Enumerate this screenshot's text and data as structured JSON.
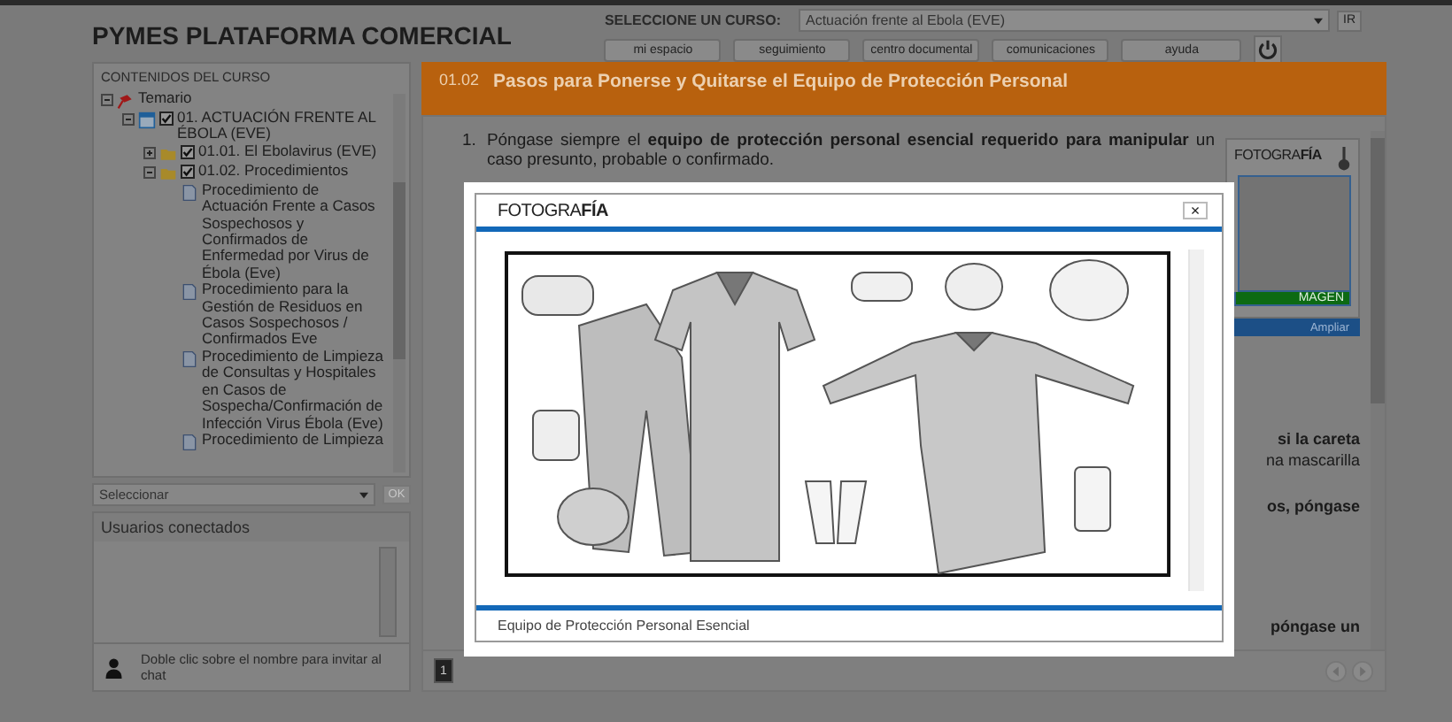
{
  "header": {
    "title": "PYMES PLATAFORMA COMERCIAL",
    "course_label": "SELECCIONE UN CURSO:",
    "course_value": "Actuación frente al Ebola (EVE)",
    "go_button": "IR",
    "nav": [
      "mi espacio",
      "seguimiento",
      "centro documental",
      "comunicaciones",
      "ayuda"
    ]
  },
  "sidebar": {
    "title": "CONTENIDOS DEL CURSO",
    "tree": [
      {
        "label": "Temario",
        "kind": "root",
        "expanded": true,
        "children": [
          {
            "label": "01. ACTUACIÓN FRENTE AL ÉBOLA (EVE)",
            "kind": "module",
            "checked": true,
            "expanded": true,
            "children": [
              {
                "label": "01.01. El Ebolavirus (EVE)",
                "kind": "folder",
                "checked": true,
                "expanded": false
              },
              {
                "label": "01.02. Procedimientos",
                "kind": "folder",
                "checked": true,
                "expanded": true,
                "children": [
                  {
                    "label": "Procedimiento de Actuación Frente a Casos Sospechosos y Confirmados de Enfermedad por Virus de Ébola (Eve)",
                    "kind": "document"
                  },
                  {
                    "label": "Procedimiento para la Gestión de Residuos en Casos Sospechosos / Confirmados Eve",
                    "kind": "document"
                  },
                  {
                    "label": "Procedimiento de Limpieza de Consultas y Hospitales en Casos de Sospecha/Confirmación de Infección Virus Ébola (Eve)",
                    "kind": "document"
                  },
                  {
                    "label": "Procedimiento de Limpieza",
                    "kind": "document"
                  }
                ]
              }
            ]
          }
        ]
      }
    ],
    "select": {
      "value": "Seleccionar",
      "ok_button": "OK",
      "ok_disabled": true
    },
    "users": {
      "title": "Usuarios conectados",
      "hint": "Doble clic sobre el nombre para invitar al chat"
    }
  },
  "content": {
    "number": "01.02",
    "title": "Pasos para Ponerse y Quitarse el Equipo de Protección Personal",
    "steps": [
      {
        "number": "1.",
        "text": "Póngase siempre el **equipo de protección personal esencial requerido para manipular** un caso presunto, probable o confirmado."
      }
    ],
    "thumbnail": {
      "logo": "FOTOGRA**FÍA**",
      "label": "MAGEN",
      "button": "Ampliar"
    },
    "fragments": [
      {
        "text": "si la careta",
        "bold": true
      },
      {
        "text": "na mascarilla",
        "bold": false
      },
      {
        "text": "os, póngase",
        "bold": true
      },
      {
        "text": "póngase un",
        "bold": true
      }
    ],
    "page_button": "1"
  },
  "dialog": {
    "logo": "FOTOGRA**FÍA**",
    "close": "×",
    "caption": "Equipo de Protección Personal Esencial"
  }
}
